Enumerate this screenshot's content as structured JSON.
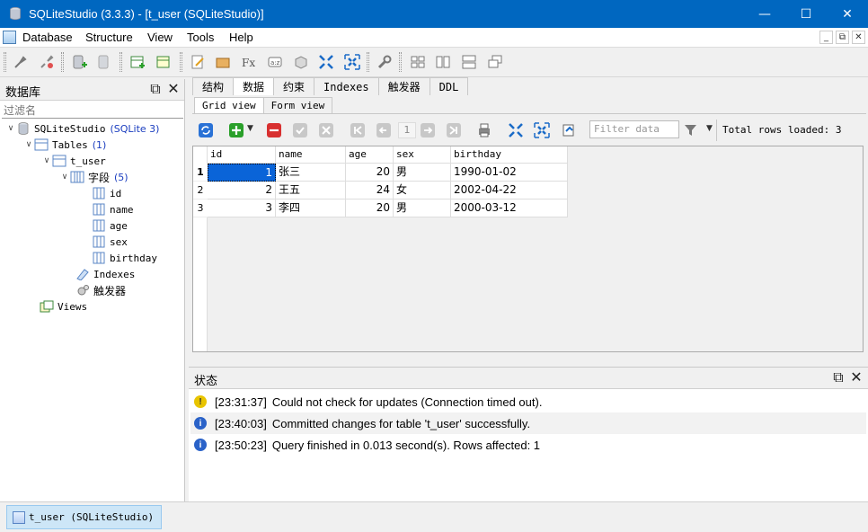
{
  "window": {
    "title": "SQLiteStudio (3.3.3) - [t_user (SQLiteStudio)]",
    "controls": {
      "minimize": "—",
      "maximize": "☐",
      "close": "✕"
    }
  },
  "menu": {
    "items": [
      "Database",
      "Structure",
      "View",
      "Tools",
      "Help"
    ],
    "mdi_controls": [
      "_",
      "⧉",
      "✕"
    ]
  },
  "db_panel": {
    "title": "数据库",
    "controls": {
      "restore": "⧉",
      "close": "✕"
    },
    "filter_placeholder": "过滤名",
    "tree": {
      "db": {
        "name": "SQLiteStudio",
        "type": "(SQLite 3)"
      },
      "tables": {
        "name": "Tables",
        "count": "(1)"
      },
      "table": {
        "name": "t_user"
      },
      "columns_group": {
        "name": "字段",
        "count": "(5)"
      },
      "columns": [
        "id",
        "name",
        "age",
        "sex",
        "birthday"
      ],
      "indexes": "Indexes",
      "triggers": "触发器",
      "views": "Views"
    }
  },
  "editor": {
    "tabs": [
      "结构",
      "数据",
      "约束",
      "Indexes",
      "触发器",
      "DDL"
    ],
    "active_tab": "数据",
    "subtabs": [
      "Grid view",
      "Form view"
    ],
    "active_subtab": "Grid view",
    "page_number": "1",
    "filter_placeholder": "Filter data",
    "total_rows": "Total rows loaded: 3",
    "grid": {
      "columns": [
        "id",
        "name",
        "age",
        "sex",
        "birthday"
      ],
      "rows": [
        {
          "num": "1",
          "id": "1",
          "name": "张三",
          "age": "20",
          "sex": "男",
          "birthday": "1990-01-02"
        },
        {
          "num": "2",
          "id": "2",
          "name": "王五",
          "age": "24",
          "sex": "女",
          "birthday": "2002-04-22"
        },
        {
          "num": "3",
          "id": "3",
          "name": "李四",
          "age": "20",
          "sex": "男",
          "birthday": "2000-03-12"
        }
      ]
    }
  },
  "status_panel": {
    "title": "状态",
    "controls": {
      "restore": "⧉",
      "close": "✕"
    },
    "messages": [
      {
        "level": "warning",
        "icon": "!",
        "time": "[23:31:37]",
        "text": "Could not check for updates (Connection timed out)."
      },
      {
        "level": "info",
        "icon": "i",
        "time": "[23:40:03]",
        "text": "Committed changes for table 't_user' successfully."
      },
      {
        "level": "info",
        "icon": "i",
        "time": "[23:50:23]",
        "text": "Query finished in 0.013 second(s). Rows affected: 1"
      }
    ]
  },
  "taskbar": {
    "window_label": "t_user (SQLiteStudio)"
  },
  "colors": {
    "titlebar": "#0067c0",
    "selection": "#0a64d8",
    "count_blue": "#1a3dbf",
    "warning": "#e8c400",
    "info": "#2a62c8"
  }
}
